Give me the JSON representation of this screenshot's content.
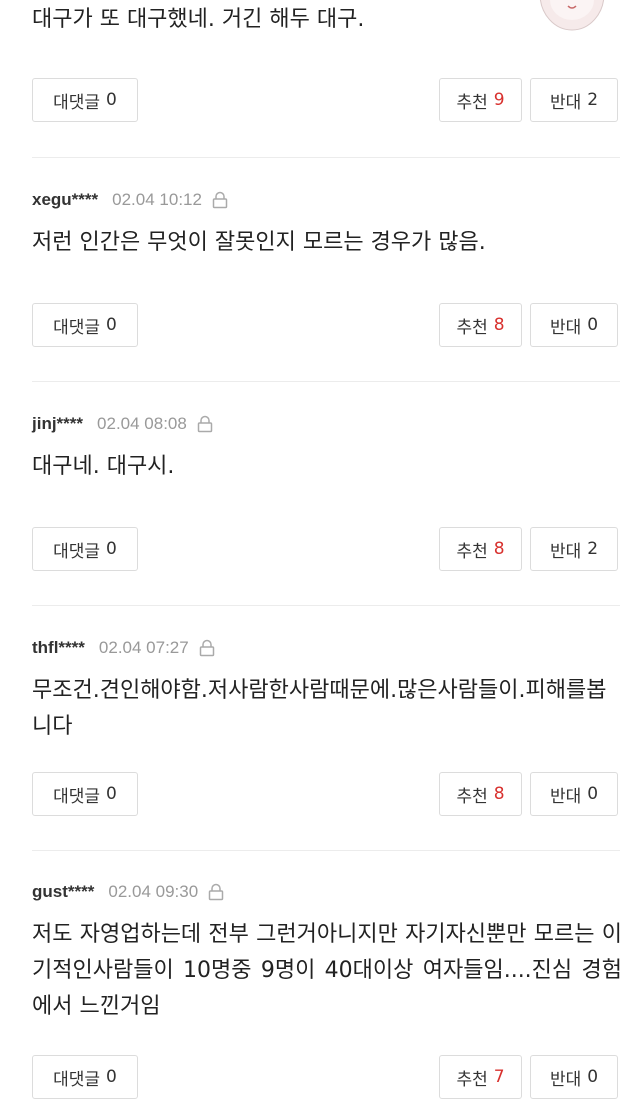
{
  "labels": {
    "reply": "대댓글",
    "recommend": "추천",
    "oppose": "반대"
  },
  "comments": [
    {
      "user": "",
      "date": "",
      "text": "대구가 또 대구했네. 거긴 해두 대구.",
      "replies": "0",
      "recommend": "9",
      "oppose": "2"
    },
    {
      "user": "xegu****",
      "date": "02.04 10:12",
      "text": "저런 인간은 무엇이 잘못인지 모르는 경우가 많음.",
      "replies": "0",
      "recommend": "8",
      "oppose": "0"
    },
    {
      "user": "jinj****",
      "date": "02.04 08:08",
      "text": "대구네. 대구시.",
      "replies": "0",
      "recommend": "8",
      "oppose": "2"
    },
    {
      "user": "thfl****",
      "date": "02.04 07:27",
      "text": "무조건.견인해야함.저사람한사람때문에.많은사람들이.피해를봅니다",
      "replies": "0",
      "recommend": "8",
      "oppose": "0"
    },
    {
      "user": "gust****",
      "date": "02.04 09:30",
      "text": "저도 자영업하는데 전부 그런거아니지만 자기자신뿐만 모르는 이기적인사람들이 10명중 9명이 40대이상 여자들임....진심 경험에서 느낀거임",
      "replies": "0",
      "recommend": "7",
      "oppose": "0"
    }
  ],
  "colors": {
    "accent": "#d8312e",
    "border": "#dcdcdc",
    "meta": "#999999"
  }
}
